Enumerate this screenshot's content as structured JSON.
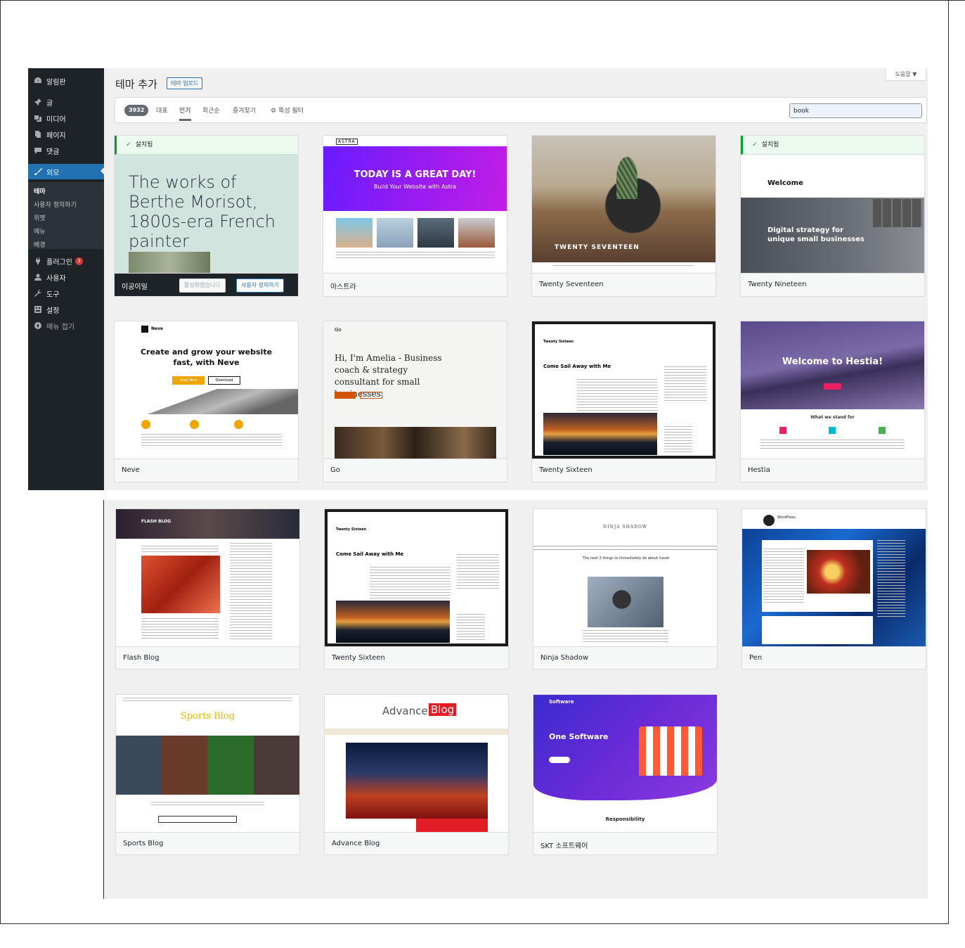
{
  "sidebar": {
    "items": [
      {
        "label": "알림판",
        "icon": "dashboard-icon"
      },
      {
        "label": "글",
        "icon": "pin-icon"
      },
      {
        "label": "미디어",
        "icon": "media-icon"
      },
      {
        "label": "페이지",
        "icon": "page-icon"
      },
      {
        "label": "댓글",
        "icon": "comment-icon"
      },
      {
        "label": "외모",
        "icon": "brush-icon"
      },
      {
        "label": "플러그인",
        "icon": "plugin-icon",
        "badge": "3"
      },
      {
        "label": "사용자",
        "icon": "user-icon"
      },
      {
        "label": "도구",
        "icon": "wrench-icon"
      },
      {
        "label": "설정",
        "icon": "settings-icon"
      },
      {
        "label": "메뉴 접기",
        "icon": "collapse-icon"
      }
    ],
    "submenu": [
      "테마",
      "사용자 정의하기",
      "위젯",
      "메뉴",
      "배경"
    ]
  },
  "header": {
    "title": "테마 추가",
    "upload": "테마 업로드",
    "help": "도움말 ▼"
  },
  "filter": {
    "count": "3932",
    "tabs": [
      "대표",
      "인기",
      "최근순",
      "즐겨찾기"
    ],
    "feature": "특성 필터",
    "search_value": "book"
  },
  "cards": {
    "installed": "설치됨",
    "active_label": "이공이일",
    "activated": "활성화했습니다",
    "customize": "사용자 정의하기",
    "names": [
      "아스트라",
      "Twenty Seventeen",
      "Twenty Nineteen",
      "Neve",
      "Go",
      "Twenty Sixteen",
      "Hestia",
      "Flash Blog",
      "Twenty Sixteen",
      "Ninja Shadow",
      "Pen",
      "Sports Blog",
      "Advance Blog",
      "SKT 소프트웨어"
    ]
  },
  "previews": {
    "tt1": "The works of Berthe Morisot, 1800s-era French painter",
    "astra_logo": "ASTRA",
    "astra_head": "TODAY IS A GREAT DAY!",
    "astra_sub": "Build Your Website with Astra",
    "t17": "TWENTY SEVENTEEN",
    "t19_welcome": "Welcome",
    "t19_digital": "Digital strategy for unique small businesses",
    "neve_logo": "Neve",
    "neve_head": "Create and grow your website fast, with Neve",
    "neve_btn1": "Start Now",
    "neve_btn2": "Download",
    "go_logo": "Go",
    "go_head": "Hi, I'm Amelia - Business coach & strategy consultant for small businesses.",
    "t16_title": "Twenty Sixteen",
    "t16_post": "Come Sail Away with Me",
    "hestia_head": "Welcome to Hestia!",
    "hestia_stand": "What we stand for",
    "flash_logo": "FLASH BLOG",
    "ninja_logo": "NINJA SHADOW",
    "ninja_post": "The next 3 things to immediately do about travel",
    "pen_logo": "WordPress",
    "sports_logo": "Sports Blog",
    "advance_a": "Advance",
    "advance_b": "Blog",
    "skt_logo": "Software",
    "skt_head": "One Software",
    "skt_resp": "Responsibility"
  },
  "colors": {
    "sidebar": "#1e2327",
    "accent": "#2271b1",
    "installed": "#00a32a",
    "astra_from": "#6a1bff",
    "astra_to": "#c21de6",
    "hestia": "#5a4a8a",
    "skt": "#5b2bd6"
  }
}
